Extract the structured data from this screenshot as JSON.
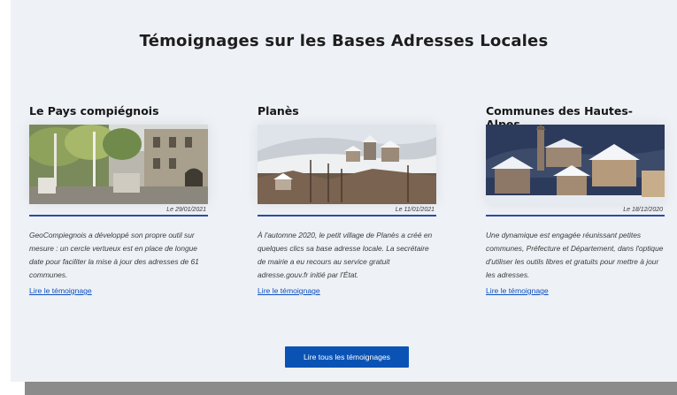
{
  "section": {
    "title": "Témoignages sur les Bases Adresses Locales",
    "cta_label": "Lire tous les témoignages"
  },
  "colors": {
    "accent": "#0a53b5",
    "rule": "#2a4ea0",
    "background": "#eef1f6"
  },
  "cards": [
    {
      "title": "Le Pays compiégnois",
      "date": "Le 29/01/2021",
      "description": "GeoCompiegnois a développé son propre outil sur mesure : un cercle vertueux est en place de longue date pour faciliter la mise à jour des adresses de 61 communes.",
      "link_label": "Lire le témoignage",
      "image": "town-square-photo"
    },
    {
      "title": "Planès",
      "date": "Le 11/01/2021",
      "description": "À l'automne 2020, le petit village de Planès a créé en quelques clics sa base adresse locale. La secrétaire de mairie a eu recours au service gratuit adresse.gouv.fr initié par l'État.",
      "link_label": "Lire le témoignage",
      "image": "snowy-village-photo"
    },
    {
      "title": "Communes des Hautes-Alpes",
      "date": "Le 18/12/2020",
      "description": "Une dynamique est engagée réunissant petites communes, Préfecture et Département, dans l'optique d'utiliser les outils libres et gratuits pour mettre à jour les adresses.",
      "link_label": "Lire le témoignage",
      "image": "alpine-village-photo"
    }
  ]
}
